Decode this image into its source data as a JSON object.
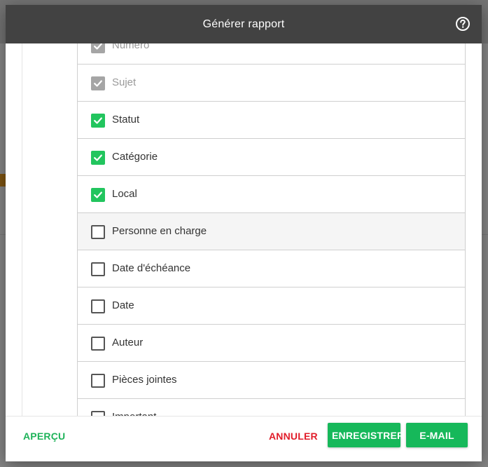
{
  "dialog": {
    "title": "Générer rapport",
    "help_icon": "help-circle-icon"
  },
  "fields": [
    {
      "label": "Numéro",
      "state": "disabled"
    },
    {
      "label": "Sujet",
      "state": "disabled"
    },
    {
      "label": "Statut",
      "state": "checked"
    },
    {
      "label": "Catégorie",
      "state": "checked"
    },
    {
      "label": "Local",
      "state": "checked"
    },
    {
      "label": "Personne en charge",
      "state": "unchecked"
    },
    {
      "label": "Date d'échéance",
      "state": "unchecked"
    },
    {
      "label": "Date",
      "state": "unchecked"
    },
    {
      "label": "Auteur",
      "state": "unchecked"
    },
    {
      "label": "Pièces jointes",
      "state": "unchecked"
    },
    {
      "label": "Important",
      "state": "unchecked"
    }
  ],
  "footer": {
    "preview_label": "APERÇU",
    "cancel_label": "ANNULER",
    "save_label": "ENREGISTRER",
    "email_label": "E-MAIL"
  },
  "colors": {
    "header_bg": "#424242",
    "check_green": "#22c55e",
    "primary_green": "#16b85a",
    "cancel_red": "#e11d2a"
  }
}
